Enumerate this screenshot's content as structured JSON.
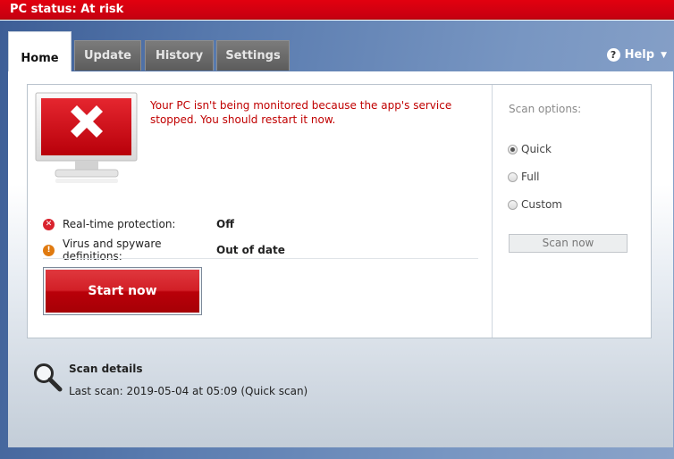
{
  "title": "PC status: At risk",
  "tabs": [
    {
      "label": "Home"
    },
    {
      "label": "Update"
    },
    {
      "label": "History"
    },
    {
      "label": "Settings"
    }
  ],
  "help": {
    "label": "Help",
    "icon": "help-icon"
  },
  "alert": {
    "icon": "red-x-monitor-icon",
    "message": "Your PC isn't being monitored because the app's service stopped. You should restart it now."
  },
  "status": [
    {
      "label": "Real-time protection:",
      "value": "Off",
      "icon": "error-icon",
      "color": "#d9232e"
    },
    {
      "label": "Virus and spyware definitions:",
      "value": "Out of date",
      "icon": "warning-icon",
      "color": "#e07a10"
    }
  ],
  "start_button": {
    "label": "Start now"
  },
  "scan_options": {
    "title": "Scan options:",
    "options": [
      {
        "label": "Quick",
        "selected": true
      },
      {
        "label": "Full",
        "selected": false
      },
      {
        "label": "Custom",
        "selected": false
      }
    ],
    "button": "Scan now"
  },
  "scan_details": {
    "title": "Scan details",
    "last_scan_label": "Last scan:",
    "last_scan_value": "2019-05-04 at 05:09 (Quick scan)"
  },
  "colors": {
    "title_bar": "#d6000f",
    "alert_text": "#c00000",
    "accent": "#3d5e96"
  }
}
